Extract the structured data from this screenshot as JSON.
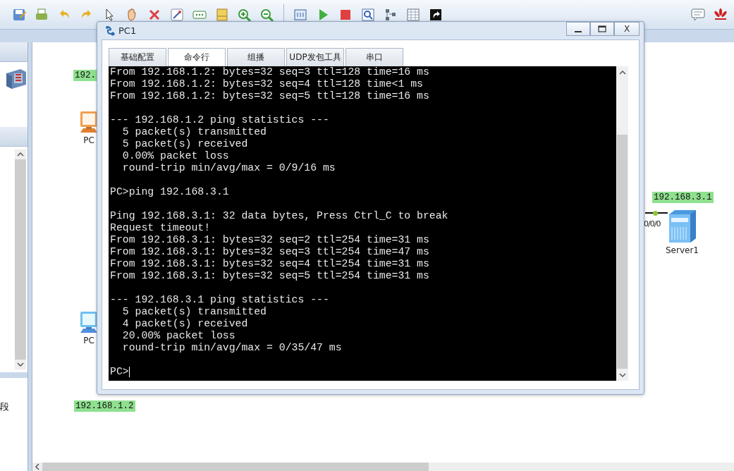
{
  "canvas": {
    "labels": [
      {
        "text": "192."
      },
      {
        "text": "192.168.1.2"
      },
      {
        "text": "192.168.3.1"
      }
    ],
    "devices": [
      {
        "kind": "pc-orange",
        "label": "PC"
      },
      {
        "kind": "pc-blue",
        "label": "PC"
      },
      {
        "kind": "server",
        "label": "Server1"
      }
    ],
    "port_label": "0/0/0"
  },
  "left_panel": {
    "text": "段"
  },
  "dialog": {
    "title": "PC1",
    "tabs": [
      {
        "label": "基础配置",
        "selected": false
      },
      {
        "label": "命令行",
        "selected": true
      },
      {
        "label": "组播",
        "selected": false
      },
      {
        "label": "UDP发包工具",
        "selected": false
      },
      {
        "label": "串口",
        "selected": false
      }
    ],
    "close_label": "X",
    "terminal": {
      "blocks": [
        [
          "From 192.168.1.2: bytes=32 seq=3 ttl=128 time=16 ms",
          "From 192.168.1.2: bytes=32 seq=4 ttl=128 time<1 ms",
          "From 192.168.1.2: bytes=32 seq=5 ttl=128 time=16 ms"
        ],
        [
          "--- 192.168.1.2 ping statistics ---",
          "  5 packet(s) transmitted",
          "  5 packet(s) received",
          "  0.00% packet loss",
          "  round-trip min/avg/max = 0/9/16 ms"
        ],
        [
          "PC>ping 192.168.3.1"
        ],
        [
          "Ping 192.168.3.1: 32 data bytes, Press Ctrl_C to break",
          "Request timeout!",
          "From 192.168.3.1: bytes=32 seq=2 ttl=254 time=31 ms",
          "From 192.168.3.1: bytes=32 seq=3 ttl=254 time=47 ms",
          "From 192.168.3.1: bytes=32 seq=4 ttl=254 time=31 ms",
          "From 192.168.3.1: bytes=32 seq=5 ttl=254 time=31 ms"
        ],
        [
          "--- 192.168.3.1 ping statistics ---",
          "  5 packet(s) transmitted",
          "  4 packet(s) received",
          "  20.00% packet loss",
          "  round-trip min/avg/max = 0/35/47 ms"
        ]
      ],
      "prompt": "PC>"
    }
  }
}
